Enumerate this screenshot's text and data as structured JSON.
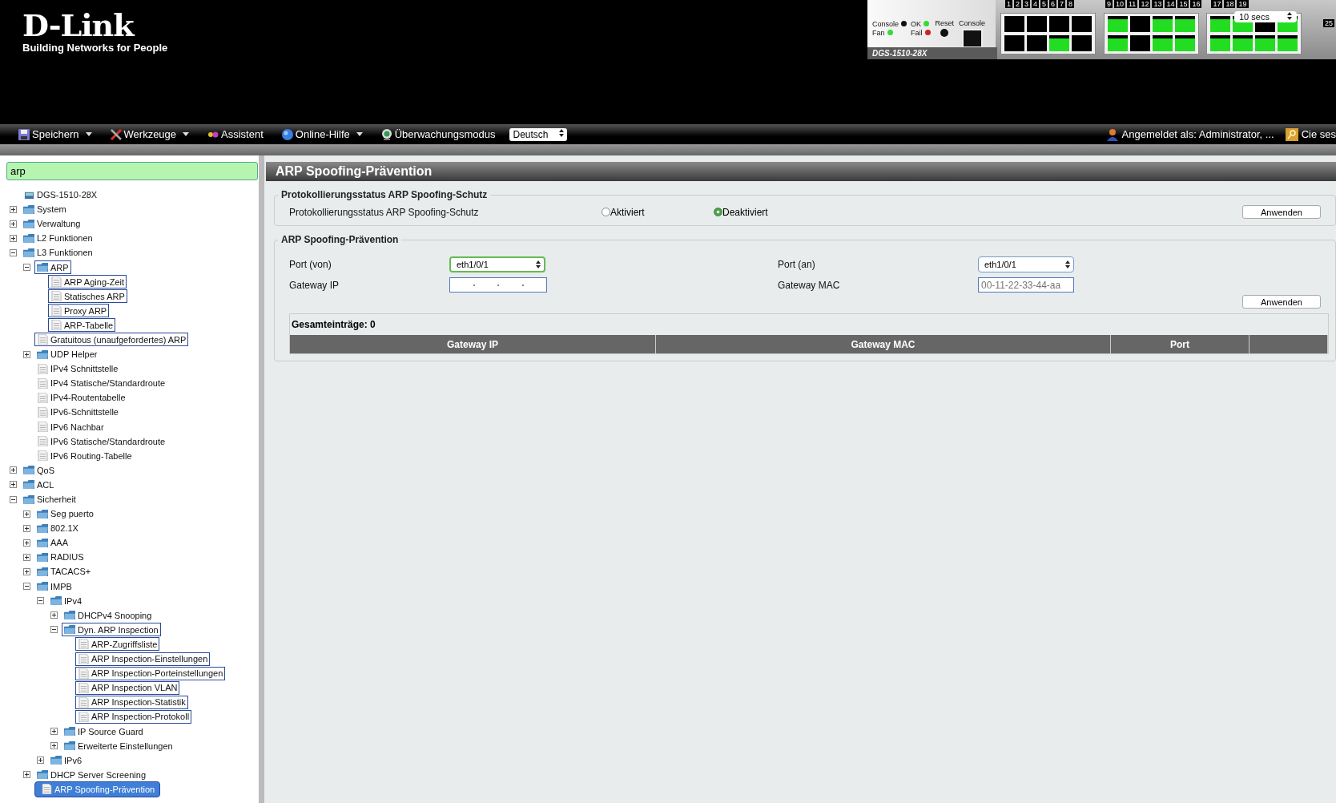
{
  "header": {
    "logo": "D-Link",
    "tagline": "Building Networks for People"
  },
  "device": {
    "model": "DGS-1510-28X",
    "console_label": "Console",
    "reset_label": "Reset",
    "refresh": "10 secs",
    "extra_port": "25",
    "leds": [
      {
        "label": "Console",
        "color": "#111111"
      },
      {
        "label": "Fan",
        "color": "#33dd33"
      },
      {
        "label": "OK",
        "color": "#33dd33"
      },
      {
        "label": "Fail",
        "color": "#cc2222"
      }
    ],
    "port_groups": [
      {
        "labels": [
          "1",
          "2",
          "3",
          "4",
          "5",
          "6",
          "7",
          "8"
        ],
        "top": [
          false,
          false,
          false,
          false
        ],
        "bottom": [
          false,
          false,
          true,
          false
        ]
      },
      {
        "labels": [
          "9",
          "10",
          "11",
          "12",
          "13",
          "14",
          "15",
          "16"
        ],
        "top": [
          true,
          false,
          true,
          true
        ],
        "bottom": [
          true,
          false,
          true,
          true
        ]
      },
      {
        "labels": [
          "17",
          "18",
          "19"
        ],
        "top": [
          true,
          true,
          false,
          true
        ],
        "bottom": [
          true,
          true,
          true,
          true
        ]
      }
    ]
  },
  "toolbar": {
    "items": [
      {
        "label": "Speichern",
        "kind": "save",
        "dropdown": true
      },
      {
        "label": "Werkzeuge",
        "kind": "tools",
        "dropdown": true
      },
      {
        "label": "Assistent",
        "kind": "wizard",
        "dropdown": false
      },
      {
        "label": "Online-Hilfe",
        "kind": "help",
        "dropdown": true
      },
      {
        "label": "Überwachungsmodus",
        "kind": "monitor",
        "dropdown": false
      }
    ],
    "language": "Deutsch",
    "user": "Angemeldet als: Administrator, ...",
    "session": "Cie ses"
  },
  "sidebar": {
    "search": "arp",
    "tree": [
      {
        "label": "DGS-1510-28X",
        "kind": "device",
        "match": false,
        "selected": false
      },
      {
        "label": "System",
        "kind": "folder",
        "expanded": false,
        "match": false,
        "selected": false
      },
      {
        "label": "Verwaltung",
        "kind": "folder",
        "expanded": false,
        "match": false,
        "selected": false
      },
      {
        "label": "L2 Funktionen",
        "kind": "folder",
        "expanded": false,
        "match": false,
        "selected": false
      },
      {
        "label": "L3 Funktionen",
        "kind": "folder",
        "expanded": true,
        "match": false,
        "selected": false,
        "children": [
          {
            "label": "ARP",
            "kind": "folder",
            "expanded": true,
            "match": true,
            "selected": false,
            "children": [
              {
                "label": "ARP Aging-Zeit",
                "kind": "page",
                "match": true,
                "selected": false
              },
              {
                "label": "Statisches ARP",
                "kind": "page",
                "match": true,
                "selected": false
              },
              {
                "label": "Proxy ARP",
                "kind": "page",
                "match": true,
                "selected": false
              },
              {
                "label": "ARP-Tabelle",
                "kind": "page",
                "match": true,
                "selected": false
              }
            ]
          },
          {
            "label": "Gratuitous (unaufgefordertes) ARP",
            "kind": "page",
            "match": true,
            "selected": false
          },
          {
            "label": "UDP Helper",
            "kind": "folder",
            "expanded": false,
            "match": false,
            "selected": false
          },
          {
            "label": "IPv4 Schnittstelle",
            "kind": "page",
            "match": false,
            "selected": false
          },
          {
            "label": "IPv4 Statische/Standardroute",
            "kind": "page",
            "match": false,
            "selected": false
          },
          {
            "label": "IPv4-Routentabelle",
            "kind": "page",
            "match": false,
            "selected": false
          },
          {
            "label": "IPv6-Schnittstelle",
            "kind": "page",
            "match": false,
            "selected": false
          },
          {
            "label": "IPv6 Nachbar",
            "kind": "page",
            "match": false,
            "selected": false
          },
          {
            "label": "IPv6 Statische/Standardroute",
            "kind": "page",
            "match": false,
            "selected": false
          },
          {
            "label": "IPv6 Routing-Tabelle",
            "kind": "page",
            "match": false,
            "selected": false
          }
        ]
      },
      {
        "label": "QoS",
        "kind": "folder",
        "expanded": false,
        "match": false,
        "selected": false
      },
      {
        "label": "ACL",
        "kind": "folder",
        "expanded": false,
        "match": false,
        "selected": false
      },
      {
        "label": "Sicherheit",
        "kind": "folder",
        "expanded": true,
        "match": false,
        "selected": false,
        "children": [
          {
            "label": "Seg puerto",
            "kind": "folder",
            "expanded": false,
            "match": false,
            "selected": false
          },
          {
            "label": "802.1X",
            "kind": "folder",
            "expanded": false,
            "match": false,
            "selected": false
          },
          {
            "label": "AAA",
            "kind": "folder",
            "expanded": false,
            "match": false,
            "selected": false
          },
          {
            "label": "RADIUS",
            "kind": "folder",
            "expanded": false,
            "match": false,
            "selected": false
          },
          {
            "label": "TACACS+",
            "kind": "folder",
            "expanded": false,
            "match": false,
            "selected": false
          },
          {
            "label": "IMPB",
            "kind": "folder",
            "expanded": true,
            "match": false,
            "selected": false,
            "children": [
              {
                "label": "IPv4",
                "kind": "folder",
                "expanded": true,
                "match": false,
                "selected": false,
                "children": [
                  {
                    "label": "DHCPv4 Snooping",
                    "kind": "folder",
                    "expanded": false,
                    "match": false,
                    "selected": false
                  },
                  {
                    "label": "Dyn. ARP Inspection",
                    "kind": "folder",
                    "expanded": true,
                    "match": true,
                    "selected": false,
                    "children": [
                      {
                        "label": "ARP-Zugriffsliste",
                        "kind": "page",
                        "match": true,
                        "selected": false
                      },
                      {
                        "label": "ARP Inspection-Einstellungen",
                        "kind": "page",
                        "match": true,
                        "selected": false
                      },
                      {
                        "label": "ARP Inspection-Porteinstellungen",
                        "kind": "page",
                        "match": true,
                        "selected": false
                      },
                      {
                        "label": "ARP Inspection VLAN",
                        "kind": "page",
                        "match": true,
                        "selected": false
                      },
                      {
                        "label": "ARP Inspection-Statistik",
                        "kind": "page",
                        "match": true,
                        "selected": false
                      },
                      {
                        "label": "ARP Inspection-Protokoll",
                        "kind": "page",
                        "match": true,
                        "selected": false
                      }
                    ]
                  },
                  {
                    "label": "IP Source Guard",
                    "kind": "folder",
                    "expanded": false,
                    "match": false,
                    "selected": false
                  },
                  {
                    "label": "Erweiterte Einstellungen",
                    "kind": "folder",
                    "expanded": false,
                    "match": false,
                    "selected": false
                  }
                ]
              },
              {
                "label": "IPv6",
                "kind": "folder",
                "expanded": false,
                "match": false,
                "selected": false
              }
            ]
          },
          {
            "label": "DHCP Server Screening",
            "kind": "folder",
            "expanded": false,
            "match": false,
            "selected": false
          },
          {
            "label": "ARP Spoofing-Prävention",
            "kind": "page",
            "match": true,
            "selected": true
          }
        ]
      }
    ]
  },
  "main": {
    "title": "ARP Spoofing-Prävention",
    "log_section": {
      "legend": "Protokollierungsstatus ARP Spoofing-Schutz",
      "label": "Protokollierungsstatus ARP Spoofing-Schutz",
      "options": [
        {
          "label": "Aktiviert",
          "selected": false
        },
        {
          "label": "Deaktiviert",
          "selected": true
        }
      ],
      "apply": "Anwenden"
    },
    "prevention_section": {
      "legend": "ARP Spoofing-Prävention",
      "port_from": {
        "label": "Port (von)",
        "value": "eth1/0/1",
        "focused": true
      },
      "port_to": {
        "label": "Port (an)",
        "value": "eth1/0/1",
        "focused": false
      },
      "gateway_ip": {
        "label": "Gateway IP"
      },
      "gateway_mac": {
        "label": "Gateway MAC",
        "placeholder": "00-11-22-33-44-aa"
      },
      "apply": "Anwenden",
      "total": "Gesamteinträge: 0",
      "table": {
        "columns": [
          "Gateway IP",
          "Gateway MAC",
          "Port"
        ]
      }
    }
  }
}
